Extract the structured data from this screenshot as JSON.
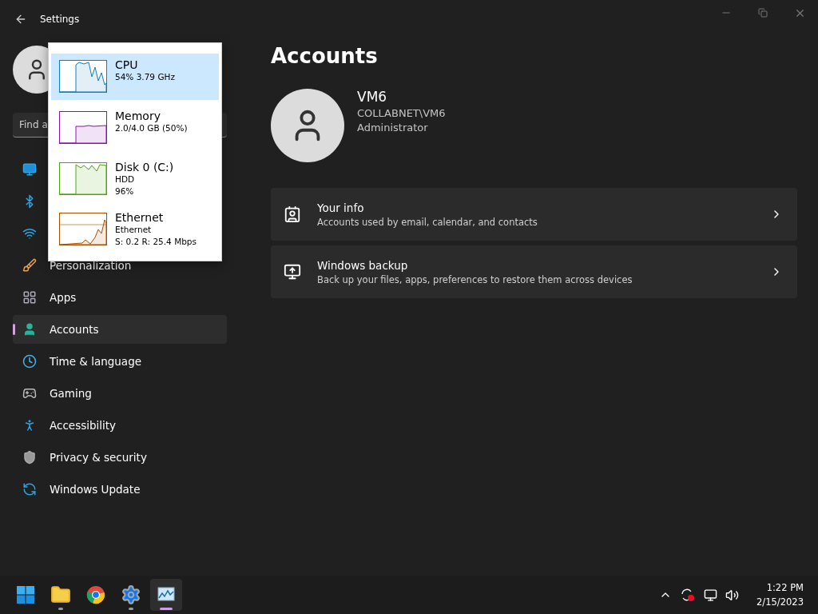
{
  "window": {
    "title": "Settings"
  },
  "sidebar": {
    "search": {
      "placeholder": "Find a"
    },
    "items": [
      {
        "selected": false
      },
      {
        "selected": false
      },
      {
        "selected": false
      },
      {
        "label": "Personalization",
        "selected": false
      },
      {
        "label": "Apps",
        "selected": false
      },
      {
        "label": "Accounts",
        "selected": true
      },
      {
        "label": "Time & language",
        "selected": false
      },
      {
        "label": "Gaming",
        "selected": false
      },
      {
        "label": "Accessibility",
        "selected": false
      },
      {
        "label": "Privacy & security",
        "selected": false
      },
      {
        "label": "Windows Update",
        "selected": false
      }
    ]
  },
  "page": {
    "title": "Accounts",
    "profile": {
      "name": "VM6",
      "account": "COLLABNET\\VM6",
      "role": "Administrator"
    },
    "cards": [
      {
        "title": "Your info",
        "description": "Accounts used by email, calendar, and contacts"
      },
      {
        "title": "Windows backup",
        "description": "Back up your files, apps, preferences to restore them across devices"
      }
    ]
  },
  "performance_popup": {
    "items": [
      {
        "name": "CPU",
        "details": [
          "54%  3.79 GHz"
        ],
        "color": "#117dbb",
        "selected": true
      },
      {
        "name": "Memory",
        "details": [
          "2.0/4.0 GB (50%)"
        ],
        "color": "#8b12ae",
        "selected": false
      },
      {
        "name": "Disk 0 (C:)",
        "details": [
          "HDD",
          "96%"
        ],
        "color": "#4da60c",
        "selected": false
      },
      {
        "name": "Ethernet",
        "details": [
          "Ethernet",
          "S: 0.2 R: 25.4 Mbps"
        ],
        "color": "#a74f01",
        "selected": false
      }
    ]
  },
  "taskbar": {
    "apps": [
      {
        "running": false,
        "selected": false
      },
      {
        "running": true,
        "selected": false
      },
      {
        "running": false,
        "selected": false
      },
      {
        "running": true,
        "selected": false
      },
      {
        "running": true,
        "selected": true
      }
    ],
    "clock": {
      "time": "1:22 PM",
      "date": "2/15/2023"
    }
  }
}
